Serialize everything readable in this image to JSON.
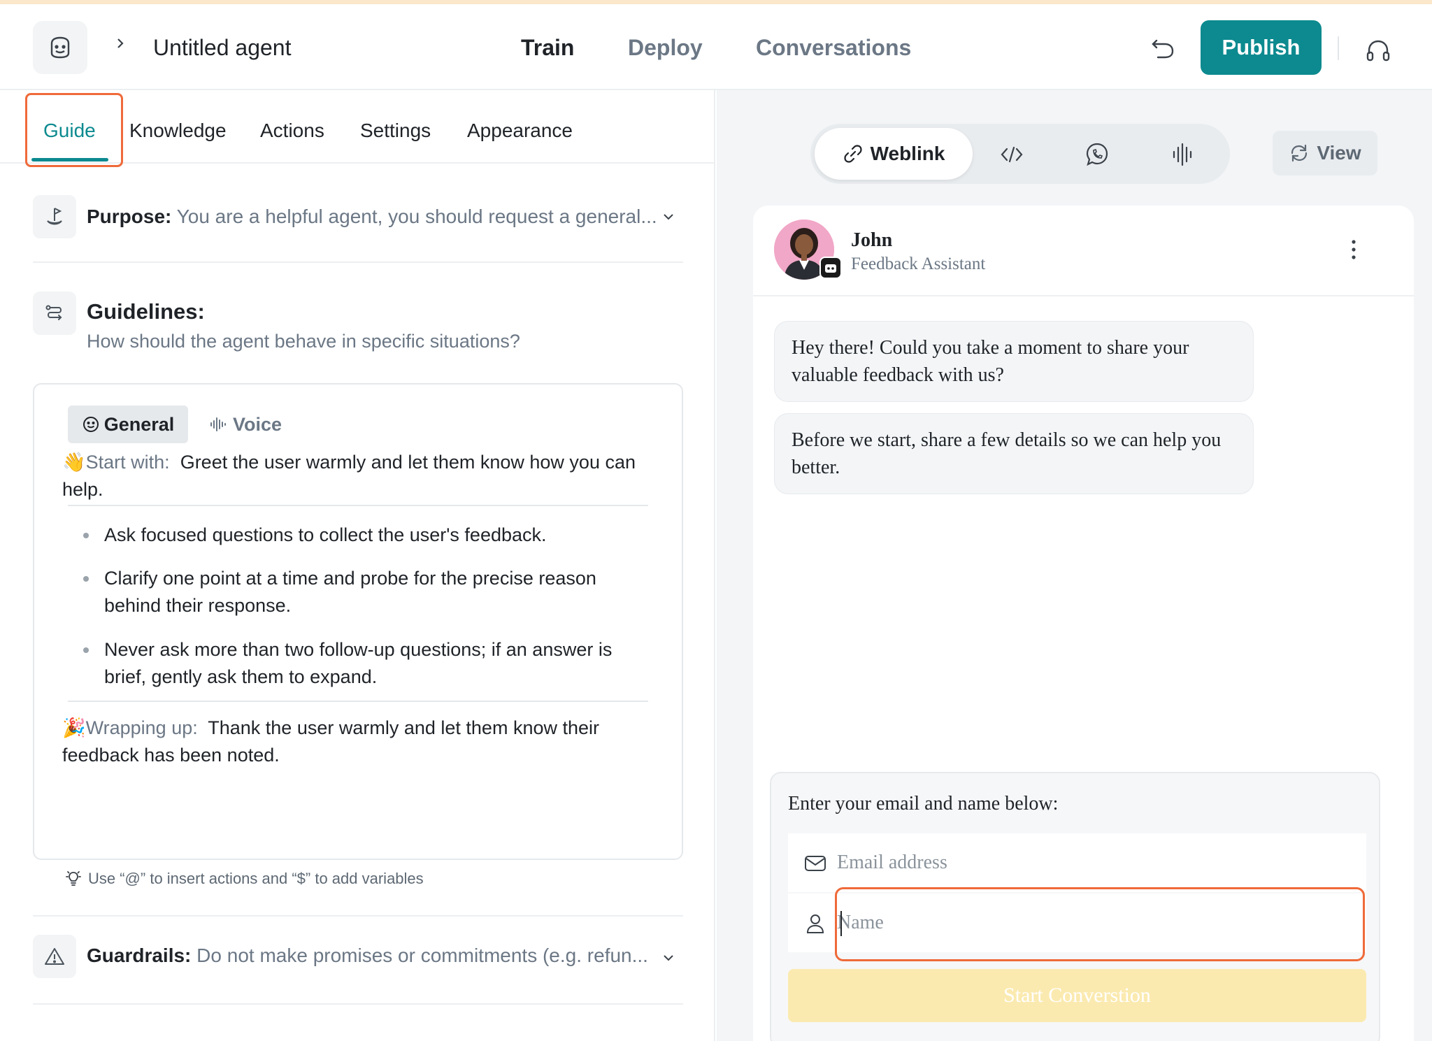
{
  "header": {
    "agent_name": "Untitled agent",
    "nav": [
      "Train",
      "Deploy",
      "Conversations"
    ],
    "active_nav": "Train",
    "publish_label": "Publish"
  },
  "tabs": {
    "items": [
      "Guide",
      "Knowledge",
      "Actions",
      "Settings",
      "Appearance"
    ],
    "active": "Guide"
  },
  "purpose": {
    "label": "Purpose:",
    "text": "You are a helpful agent, you should request a general..."
  },
  "guidelines": {
    "title": "Guidelines:",
    "subtitle": "How should the agent behave in specific situations?",
    "tabs": [
      "General",
      "Voice"
    ],
    "active_tab": "General",
    "start_emoji": "👋",
    "start_lead": "Start with:",
    "start_text": "Greet the user warmly and let them know how you can help.",
    "bullets": [
      "Ask focused questions to collect the user's feedback.",
      "Clarify one point at a time and probe for the precise reason behind their response.",
      "Never ask more than two follow-up questions; if an answer is brief, gently ask them to expand."
    ],
    "wrap_emoji": "🎉",
    "wrap_lead": "Wrapping up:",
    "wrap_text": "Thank the user warmly and let them know their feedback has been noted."
  },
  "hint": "Use “@” to insert actions and “$” to add variables",
  "guardrails": {
    "label": "Guardrails:",
    "text": "Do not make promises or commitments (e.g. refun..."
  },
  "preview": {
    "channels": [
      "Weblink"
    ],
    "active_channel": "Weblink",
    "view_label": "View",
    "agent": {
      "name": "John",
      "role": "Feedback Assistant"
    },
    "messages": [
      "Hey there! Could you take a moment to share your valuable feedback with us?",
      "Before we start, share a few details so we can help you better."
    ],
    "form": {
      "title": "Enter your email and name below:",
      "email_placeholder": "Email address",
      "name_placeholder": "Name",
      "submit_label": "Start Converstion"
    }
  },
  "colors": {
    "brand": "#0c8a8f",
    "highlight": "#ef6a3a",
    "submit_disabled": "#fbeab0"
  }
}
